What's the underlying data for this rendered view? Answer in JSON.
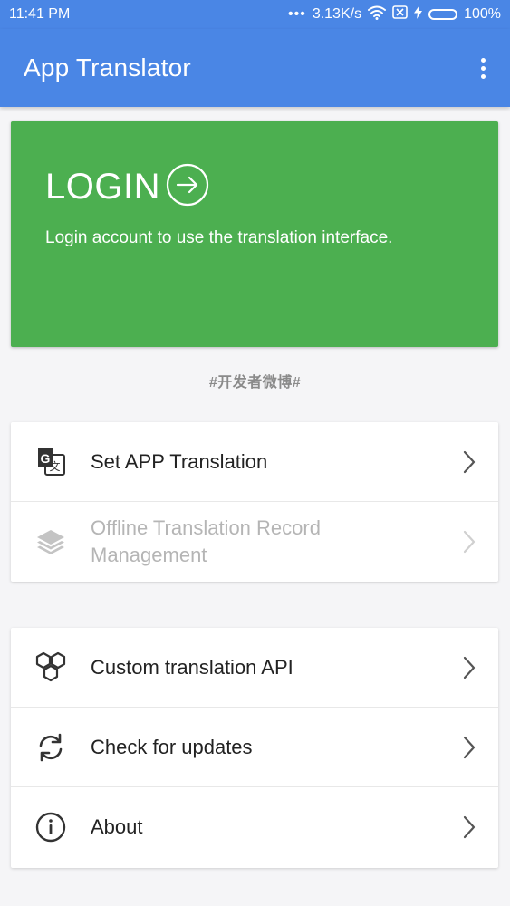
{
  "status_bar": {
    "time": "11:41 PM",
    "dots": "•••",
    "network_speed": "3.13K/s",
    "battery_percent": "100%"
  },
  "app_bar": {
    "title": "App Translator",
    "more_icon": "more-vertical-icon"
  },
  "login_card": {
    "title": "LOGIN",
    "description": "Login account to use the translation interface.",
    "arrow_icon": "arrow-right-circle-icon",
    "background_color": "#4caf50"
  },
  "developer_weibo": "#开发者微博#",
  "menu_group_1": [
    {
      "label": "Set APP Translation",
      "icon": "translate-icon",
      "enabled": true
    },
    {
      "label": "Offline Translation Record Management",
      "icon": "layers-icon",
      "enabled": false
    }
  ],
  "menu_group_2": [
    {
      "label": "Custom translation API",
      "icon": "hexagons-icon",
      "enabled": true
    },
    {
      "label": "Check for updates",
      "icon": "sync-icon",
      "enabled": true
    },
    {
      "label": "About",
      "icon": "info-icon",
      "enabled": true
    }
  ],
  "colors": {
    "primary": "#4a86e5",
    "login_green": "#4caf50",
    "battery_green": "#4cd964",
    "disabled_text": "#b5b5b5"
  }
}
